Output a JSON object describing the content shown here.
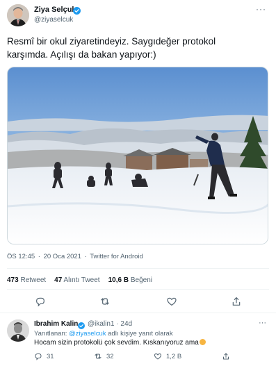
{
  "tweet": {
    "author": {
      "name": "Ziya Selçuk",
      "handle": "@ziyaselcuk",
      "verified": true
    },
    "text_line1": "Resmî bir okul ziyaretindeyiz. Saygıdeğer protokol",
    "text_line2": "karşımda. Açılışı da bakan yapıyor:)",
    "photo_icon": "snowy-field-children-photo",
    "meta": {
      "time": "ÖS 12:45",
      "separator": "·",
      "date": "20 Oca 2021",
      "source": "Twitter for Android"
    },
    "stats": {
      "retweets_count": "473",
      "retweets_label": "Retweet",
      "quotes_count": "47",
      "quotes_label": "Alıntı Tweet",
      "likes_count": "10,6 B",
      "likes_label": "Beğeni"
    },
    "actions": [
      "reply-icon",
      "retweet-icon",
      "like-icon",
      "share-icon"
    ]
  },
  "reply": {
    "author": {
      "name": "Ibrahim Kalin",
      "verified": true,
      "handle_time": "@ikalin1 · 24d"
    },
    "replying_prefix": "Yanıtlanan:",
    "replying_link": "@ziyaselcuk",
    "replying_suffix": "adlı kişiye yanıt olarak",
    "text": "Hocam sizin protokolü çok sevdim. Kıskanıyoruz ama",
    "counts": {
      "replies": "31",
      "retweets": "32",
      "likes": "1,2 B"
    }
  },
  "colors": {
    "accent": "#1d9bf0",
    "secondary_text": "#536471",
    "border": "#cfd9de"
  }
}
